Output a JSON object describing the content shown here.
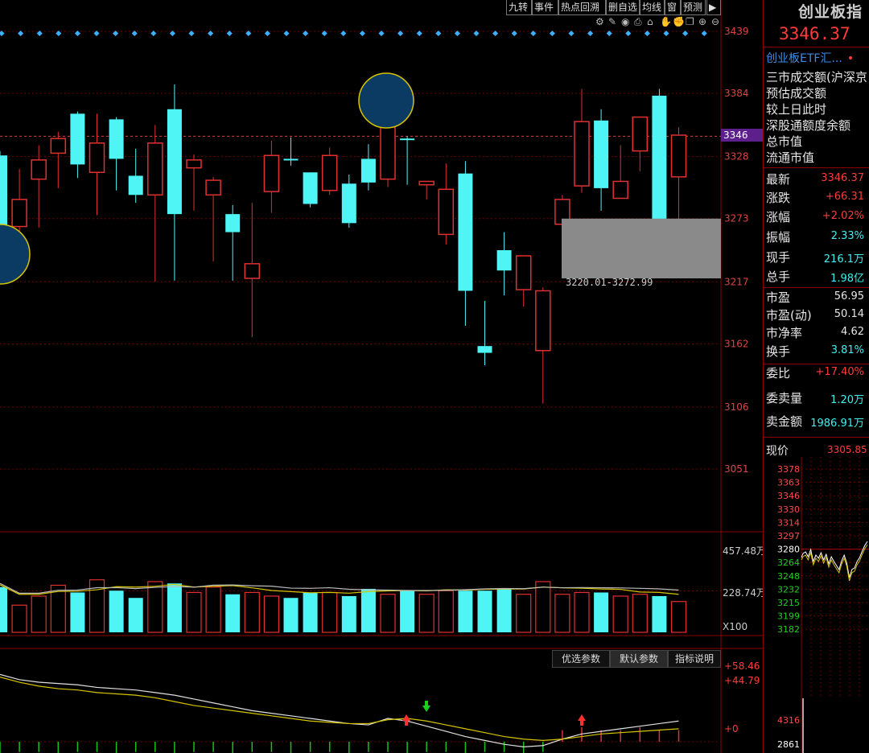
{
  "toolbar": {
    "buttons": [
      "九转",
      "事件",
      "热点回溯",
      "删自选",
      "均线",
      "窗",
      "预测"
    ],
    "icons": [
      "settings-icon",
      "pen-icon",
      "eye-icon",
      "print-icon",
      "home-icon",
      "hand-icon",
      "grab-icon",
      "copy-icon",
      "zoom-in-icon",
      "zoom-out-icon"
    ]
  },
  "main_chart": {
    "y_ticks": [
      "3439",
      "3384",
      "3328",
      "3273",
      "3217",
      "3162",
      "3106",
      "3051"
    ],
    "current_price_label": "3346",
    "zone_label": "3220.01-3272.99"
  },
  "volume": {
    "y_ticks": [
      "457.48万",
      "228.74万"
    ],
    "multiplier": "X100"
  },
  "indicator": {
    "tabs": [
      "优选参数",
      "默认参数",
      "指标说明"
    ],
    "selected_tab": "默认参数",
    "y_ticks": [
      "+58.46",
      "+44.79",
      "+0"
    ]
  },
  "panel": {
    "title": "创业板指",
    "price": "3346.37",
    "link": "创业板ETF汇...",
    "info_rows": [
      "三市成交额(沪深京",
      "预估成交额",
      "较上日此时",
      "深股通额度余额",
      "总市值",
      "流通市值"
    ],
    "quotes": [
      {
        "label": "最新",
        "value": "3346.37",
        "color": "red"
      },
      {
        "label": "涨跌",
        "value": "+66.31",
        "color": "red"
      },
      {
        "label": "涨幅",
        "value": "+2.02%",
        "color": "red"
      },
      {
        "label": "振幅",
        "value": "2.33%",
        "color": "cyan"
      },
      {
        "label": "现手",
        "value": "216.1万",
        "color": "cyan"
      },
      {
        "label": "总手",
        "value": "1.98亿",
        "color": "cyan"
      },
      {
        "label": "市盈",
        "value": "56.95",
        "color": "white"
      },
      {
        "label": "市盈(动)",
        "value": "50.14",
        "color": "white"
      },
      {
        "label": "市净率",
        "value": "4.62",
        "color": "white"
      },
      {
        "label": "换手",
        "value": "3.81%",
        "color": "cyan"
      },
      {
        "label": "委比",
        "value": "+17.40%",
        "color": "red"
      },
      {
        "label": "委卖量",
        "value": "1.20万",
        "color": "cyan"
      },
      {
        "label": "卖金额",
        "value": "1986.91万",
        "color": "cyan"
      }
    ],
    "now_price_label": "现价",
    "now_price": "3305.85",
    "mini_y_ticks": [
      "3378",
      "3363",
      "3346",
      "3330",
      "3314",
      "3297",
      "3280",
      "3264",
      "3248",
      "3232",
      "3215",
      "3199",
      "3182"
    ],
    "mini_vol_ticks": [
      "4316",
      "2861"
    ]
  },
  "chart_data": {
    "type": "candlestick",
    "y_range": [
      3051,
      3439
    ],
    "y_ticks": [
      3439,
      3384,
      3328,
      3273,
      3217,
      3162,
      3106,
      3051
    ],
    "candles": [
      {
        "o": 3254,
        "h": 3333,
        "l": 3220,
        "c": 3329,
        "up": false
      },
      {
        "o": 3266,
        "h": 3317,
        "l": 3230,
        "c": 3290,
        "up": true
      },
      {
        "o": 3308,
        "h": 3338,
        "l": 3265,
        "c": 3325,
        "up": true
      },
      {
        "o": 3331,
        "h": 3350,
        "l": 3300,
        "c": 3344,
        "up": true
      },
      {
        "o": 3321,
        "h": 3368,
        "l": 3309,
        "c": 3366,
        "up": false
      },
      {
        "o": 3314,
        "h": 3366,
        "l": 3276,
        "c": 3340,
        "up": true
      },
      {
        "o": 3326,
        "h": 3363,
        "l": 3298,
        "c": 3361,
        "up": false
      },
      {
        "o": 3311,
        "h": 3335,
        "l": 3287,
        "c": 3294,
        "up": false
      },
      {
        "o": 3294,
        "h": 3356,
        "l": 3217,
        "c": 3340,
        "up": true
      },
      {
        "o": 3277,
        "h": 3392,
        "l": 3218,
        "c": 3370,
        "up": false
      },
      {
        "o": 3318,
        "h": 3330,
        "l": 3280,
        "c": 3325,
        "up": true
      },
      {
        "o": 3294,
        "h": 3310,
        "l": 3235,
        "c": 3307,
        "up": true
      },
      {
        "o": 3261,
        "h": 3285,
        "l": 3218,
        "c": 3277,
        "up": false
      },
      {
        "o": 3220,
        "h": 3287,
        "l": 3168,
        "c": 3233,
        "up": true
      },
      {
        "o": 3297,
        "h": 3342,
        "l": 3278,
        "c": 3329,
        "up": true
      },
      {
        "o": 3325,
        "h": 3345,
        "l": 3320,
        "c": 3326,
        "up": false
      },
      {
        "o": 3286,
        "h": 3312,
        "l": 3283,
        "c": 3314,
        "up": false
      },
      {
        "o": 3298,
        "h": 3336,
        "l": 3294,
        "c": 3329,
        "up": true
      },
      {
        "o": 3269,
        "h": 3312,
        "l": 3265,
        "c": 3304,
        "up": false
      },
      {
        "o": 3305,
        "h": 3339,
        "l": 3298,
        "c": 3326,
        "up": false
      },
      {
        "o": 3308,
        "h": 3348,
        "l": 3301,
        "c": 3358,
        "up": true
      },
      {
        "o": 3344,
        "h": 3346,
        "l": 3303,
        "c": 3343,
        "up": false
      },
      {
        "o": 3306,
        "h": 3306,
        "l": 3290,
        "c": 3303,
        "up": true
      },
      {
        "o": 3259,
        "h": 3322,
        "l": 3250,
        "c": 3299,
        "up": true
      },
      {
        "o": 3313,
        "h": 3324,
        "l": 3178,
        "c": 3209,
        "up": false
      },
      {
        "o": 3160,
        "h": 3200,
        "l": 3143,
        "c": 3154,
        "up": false
      },
      {
        "o": 3245,
        "h": 3261,
        "l": 3205,
        "c": 3227,
        "up": false
      },
      {
        "o": 3210,
        "h": 3240,
        "l": 3195,
        "c": 3240,
        "up": true
      },
      {
        "o": 3156,
        "h": 3212,
        "l": 3109,
        "c": 3209,
        "up": true
      },
      {
        "o": 3268,
        "h": 3294,
        "l": 3262,
        "c": 3290,
        "up": true
      },
      {
        "o": 3302,
        "h": 3388,
        "l": 3296,
        "c": 3359,
        "up": true
      },
      {
        "o": 3360,
        "h": 3370,
        "l": 3280,
        "c": 3300,
        "up": false
      },
      {
        "o": 3306,
        "h": 3338,
        "l": 3295,
        "c": 3291,
        "up": true
      },
      {
        "o": 3363,
        "h": 3363,
        "l": 3315,
        "c": 3333,
        "up": true
      },
      {
        "o": 3382,
        "h": 3388,
        "l": 3261,
        "c": 3265,
        "up": false
      },
      {
        "o": 3347,
        "h": 3354,
        "l": 3270,
        "c": 3310,
        "up": true
      }
    ],
    "volume": [
      2.5,
      1.5,
      2.0,
      2.6,
      2.2,
      2.9,
      2.3,
      1.9,
      2.8,
      2.7,
      2.2,
      2.5,
      2.1,
      2.2,
      2.0,
      1.9,
      2.2,
      2.2,
      2.0,
      2.4,
      2.1,
      2.3,
      2.1,
      2.3,
      2.3,
      2.3,
      2.4,
      2.1,
      2.8,
      2.1,
      2.2,
      2.2,
      2.0,
      2.1,
      2.0,
      1.7
    ],
    "volume_range": [
      0,
      4.5748
    ],
    "indicator_range": [
      -5,
      58.46
    ]
  }
}
